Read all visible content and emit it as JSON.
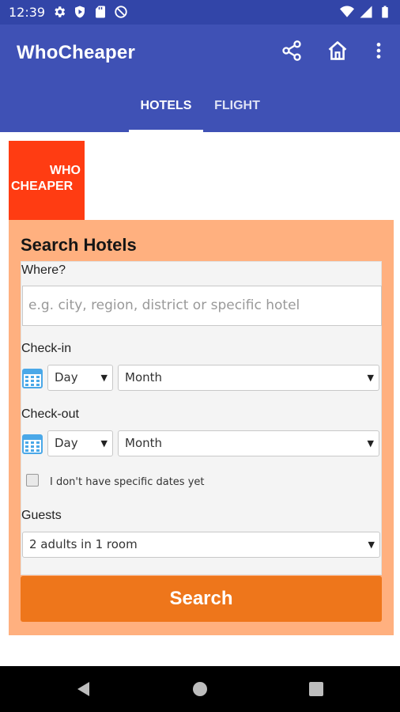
{
  "status_bar": {
    "time": "12:39",
    "left_icons": [
      "gear-icon",
      "play-protect-icon",
      "sd-card-icon",
      "no-disturb-icon"
    ],
    "right_icons": [
      "wifi-icon",
      "signal-icon",
      "battery-icon"
    ]
  },
  "app_bar": {
    "title": "WhoCheaper",
    "actions": [
      "share-icon",
      "home-icon",
      "more-vert-icon"
    ],
    "color": "#3f51b5"
  },
  "tabs": [
    {
      "label": "HOTELS",
      "active": true
    },
    {
      "label": "FLIGHT",
      "active": false
    }
  ],
  "logo": {
    "line1": "WHO",
    "line2": "CHEAPER",
    "color": "#ff3c12"
  },
  "search": {
    "title": "Search Hotels",
    "where_label": "Where?",
    "where_placeholder": "e.g. city, region, district or specific hotel",
    "checkin_label": "Check-in",
    "checkin_day": "Day",
    "checkin_month": "Month",
    "checkout_label": "Check-out",
    "checkout_day": "Day",
    "checkout_month": "Month",
    "no_dates_label": "I don't have specific dates yet",
    "guests_label": "Guests",
    "guests_value": "2 adults in 1 room",
    "button_label": "Search",
    "panel_color": "#ffb07f",
    "button_color": "#ee761b"
  },
  "nav_bar": {
    "buttons": [
      "back-icon",
      "home-circle-icon",
      "recents-icon"
    ]
  }
}
